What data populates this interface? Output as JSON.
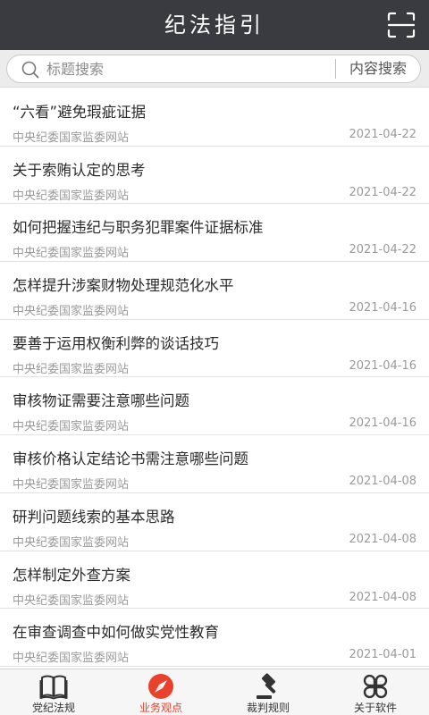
{
  "app_title": "纪法指引",
  "search": {
    "placeholder": "标题搜索",
    "content_search_label": "内容搜索"
  },
  "articles": [
    {
      "title": "“六看”避免瑕疵证据",
      "source": "中央纪委国家监委网站",
      "date": "2021-04-22"
    },
    {
      "title": "关于索贿认定的思考",
      "source": "中央纪委国家监委网站",
      "date": "2021-04-22"
    },
    {
      "title": "如何把握违纪与职务犯罪案件证据标准",
      "source": "中央纪委国家监委网站",
      "date": "2021-04-22"
    },
    {
      "title": "怎样提升涉案财物处理规范化水平",
      "source": "中央纪委国家监委网站",
      "date": "2021-04-16"
    },
    {
      "title": "要善于运用权衡利弊的谈话技巧",
      "source": "中央纪委国家监委网站",
      "date": "2021-04-16"
    },
    {
      "title": "审核物证需要注意哪些问题",
      "source": "中央纪委国家监委网站",
      "date": "2021-04-16"
    },
    {
      "title": "审核价格认定结论书需注意哪些问题",
      "source": "中央纪委国家监委网站",
      "date": "2021-04-08"
    },
    {
      "title": "研判问题线索的基本思路",
      "source": "中央纪委国家监委网站",
      "date": "2021-04-08"
    },
    {
      "title": "怎样制定外查方案",
      "source": "中央纪委国家监委网站",
      "date": "2021-04-08"
    },
    {
      "title": "在审查调查中如何做实党性教育",
      "source": "中央纪委国家监委网站",
      "date": "2021-04-01"
    }
  ],
  "tabs": [
    {
      "label": "党纪法规",
      "icon": "book-icon"
    },
    {
      "label": "业务观点",
      "icon": "compass-icon"
    },
    {
      "label": "裁判规则",
      "icon": "gavel-icon"
    },
    {
      "label": "关于软件",
      "icon": "clover-icon"
    }
  ],
  "active_tab": "业务观点",
  "colors": {
    "header_bg": "#3a3b40",
    "active_tab": "#e8412c",
    "search_bar_bg": "#ececec"
  }
}
